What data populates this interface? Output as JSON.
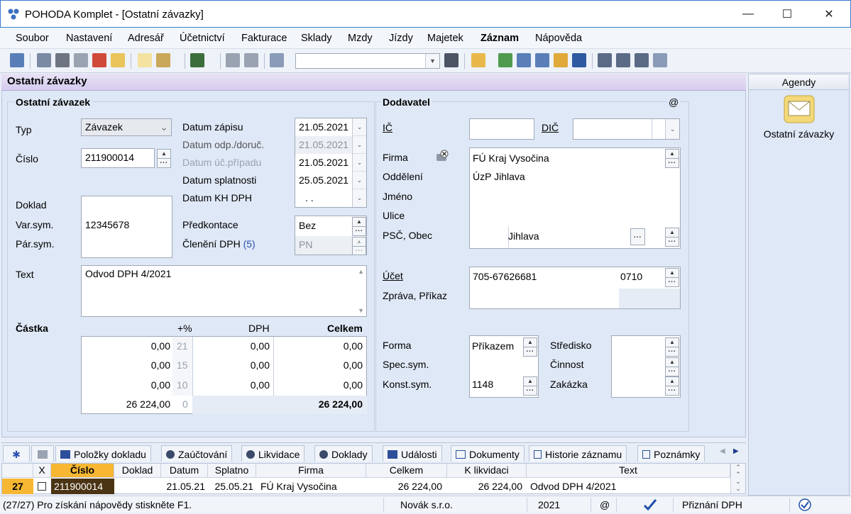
{
  "window": {
    "title": "POHODA Komplet - [Ostatní závazky]"
  },
  "menu": [
    "Soubor",
    "Nastavení",
    "Adresář",
    "Účetnictví",
    "Fakturace",
    "Sklady",
    "Mzdy",
    "Jízdy",
    "Majetek",
    "Záznam",
    "Nápověda"
  ],
  "page": {
    "title": "Ostatní závazky"
  },
  "zavazek": {
    "section_title": "Ostatní závazek",
    "typ_label": "Typ",
    "typ_value": "Závazek",
    "cislo_label": "Číslo",
    "cislo_value": "211900014",
    "datum_zapisu_label": "Datum zápisu",
    "datum_zapisu": "21.05.2021",
    "datum_odp_label": "Datum odp./doruč.",
    "datum_odp": "21.05.2021",
    "datum_uc_label": "Datum úč.případu",
    "datum_uc": "21.05.2021",
    "datum_spl_label": "Datum splatnosti",
    "datum_spl": "25.05.2021",
    "datum_kh_label": "Datum KH DPH",
    "datum_kh": ". .",
    "doklad_label": "Doklad",
    "varsym_label": "Var.sym.",
    "varsym_value": "12345678",
    "parsym_label": "Pár.sym.",
    "predkontace_label": "Předkontace",
    "predkontace_value": "Bez",
    "cleneni_label": "Členění DPH",
    "cleneni_count": "(5)",
    "cleneni_value": "PN",
    "text_label": "Text",
    "text_value": "Odvod DPH 4/2021"
  },
  "castka": {
    "label": "Částka",
    "col_pct": "+%",
    "col_dph": "DPH",
    "col_celkem": "Celkem",
    "rows": [
      {
        "base": "0,00",
        "pct": "21",
        "dph": "0,00",
        "total": "0,00"
      },
      {
        "base": "0,00",
        "pct": "15",
        "dph": "0,00",
        "total": "0,00"
      },
      {
        "base": "0,00",
        "pct": "10",
        "dph": "0,00",
        "total": "0,00"
      },
      {
        "base": "26 224,00",
        "pct": "0",
        "dph": "",
        "total": "26 224,00"
      }
    ]
  },
  "dodavatel": {
    "section_title": "Dodavatel",
    "at": "@",
    "ic_label": "IČ",
    "ic_value": "",
    "dic_label": "DIČ",
    "dic_value": "",
    "firma_label": "Firma",
    "firma_value": "FÚ Kraj Vysočina",
    "oddeleni_label": "Oddělení",
    "oddeleni_value": "ÚzP Jihlava",
    "jmeno_label": "Jméno",
    "ulice_label": "Ulice",
    "psc_label": "PSČ, Obec",
    "obec_value": "Jihlava",
    "ucet_label": "Účet",
    "ucet_value": "705-67626681",
    "banka_value": "0710",
    "zprava_label": "Zpráva, Příkaz",
    "forma_label": "Forma",
    "forma_value": "Příkazem",
    "specsym_label": "Spec.sym.",
    "konstsym_label": "Konst.sym.",
    "konstsym_value": "1148",
    "stredisko_label": "Středisko",
    "cinnost_label": "Činnost",
    "zakazka_label": "Zakázka"
  },
  "agenda": {
    "title": "Agendy",
    "item": "Ostatní závazky"
  },
  "tabs": [
    "Položky dokladu",
    "Zaúčtování",
    "Likvidace",
    "Doklady",
    "Události",
    "Dokumenty",
    "Historie záznamu",
    "Poznámky"
  ],
  "grid": {
    "headers": [
      "X",
      "Číslo",
      "Doklad",
      "Datum",
      "Splatno",
      "Firma",
      "Celkem",
      "K likvidaci",
      "Text"
    ],
    "row": {
      "index": "27",
      "cislo": "211900014",
      "doklad": "",
      "datum": "21.05.21",
      "splatno": "25.05.21",
      "firma": "FÚ Kraj Vysočina",
      "celkem": "26 224,00",
      "klikvidaci": "26 224,00",
      "text": "Odvod DPH 4/2021"
    }
  },
  "status": {
    "help": "(27/27) Pro získání nápovědy stiskněte F1.",
    "company": "Novák s.r.o.",
    "year": "2021",
    "at": "@",
    "mode": "Přiznání DPH"
  },
  "colors": {
    "accent": "#f7b733",
    "title_bg": "#d6ccef",
    "selected_row": "#4a3414"
  }
}
